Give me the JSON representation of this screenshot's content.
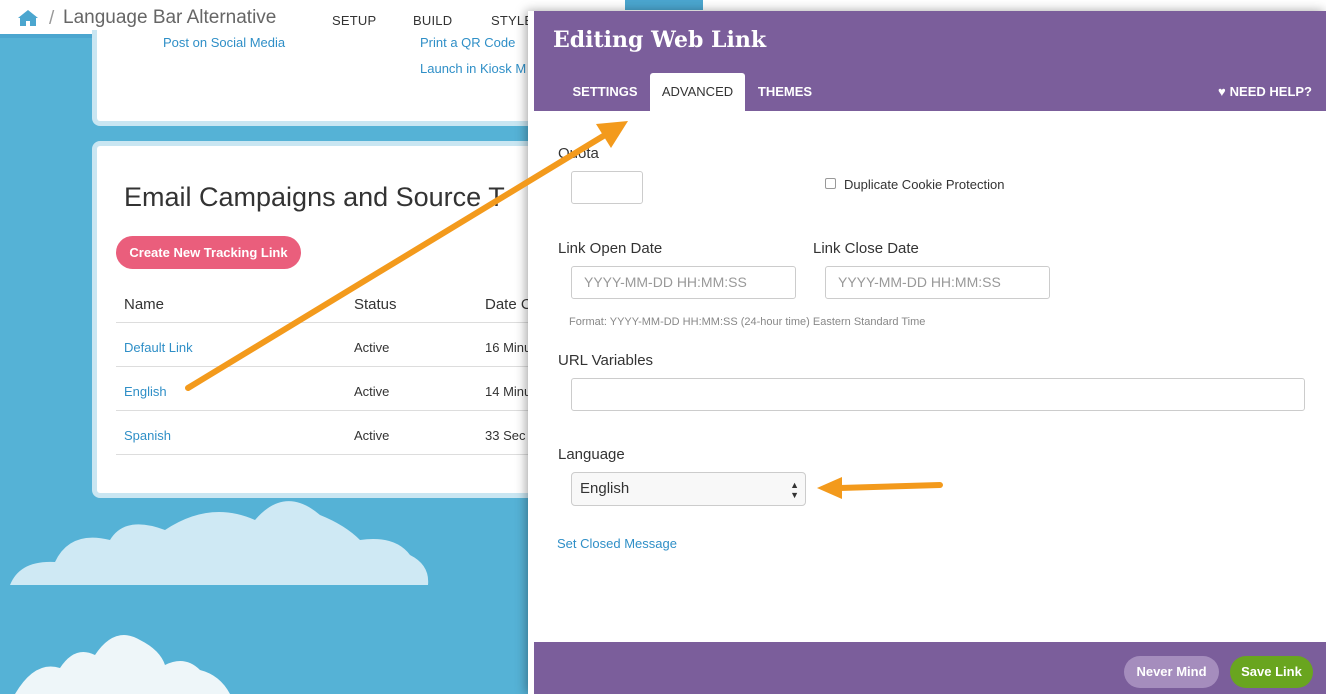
{
  "topbar": {
    "breadcrumb_separator": "/",
    "project_title": "Language Bar Alternative",
    "nav": [
      "SETUP",
      "BUILD",
      "STYLE"
    ]
  },
  "share_card": {
    "links": [
      "Post on Social Media",
      "Print a QR Code",
      "Launch in Kiosk M"
    ]
  },
  "campaigns": {
    "title": "Email Campaigns and Source T",
    "create_button": "Create New Tracking Link",
    "columns": [
      "Name",
      "Status",
      "Date C"
    ],
    "rows": [
      {
        "name": "Default Link",
        "status": "Active",
        "date": "16 Minu"
      },
      {
        "name": "English",
        "status": "Active",
        "date": "14 Minu"
      },
      {
        "name": "Spanish",
        "status": "Active",
        "date": "33 Sec"
      }
    ]
  },
  "modal": {
    "title": "Editing Web Link",
    "tabs": [
      "SETTINGS",
      "ADVANCED",
      "THEMES"
    ],
    "active_tab": "ADVANCED",
    "need_help": "NEED HELP?",
    "quota_label": "Quota",
    "quota_value": "",
    "duplicate_cookie_label": "Duplicate Cookie Protection",
    "duplicate_cookie_checked": false,
    "open_date_label": "Link Open Date",
    "open_date_placeholder": "YYYY-MM-DD HH:MM:SS",
    "close_date_label": "Link Close Date",
    "close_date_placeholder": "YYYY-MM-DD HH:MM:SS",
    "date_hint": "Format: YYYY-MM-DD HH:MM:SS (24-hour time) Eastern Standard Time",
    "url_variables_label": "URL Variables",
    "url_variables_value": "",
    "language_label": "Language",
    "language_selected": "English",
    "closed_message_link": "Set Closed Message",
    "never_mind_button": "Never Mind",
    "save_button": "Save Link"
  },
  "colors": {
    "modal_purple": "#7b5e9b",
    "sky_blue": "#55b2d6",
    "create_button_pink": "#ea5e7c",
    "save_green": "#69a51f",
    "arrow_orange": "#f39a1c"
  },
  "icons": [
    "home-icon",
    "heart-icon",
    "select-arrows-icon",
    "annotation-arrow"
  ]
}
